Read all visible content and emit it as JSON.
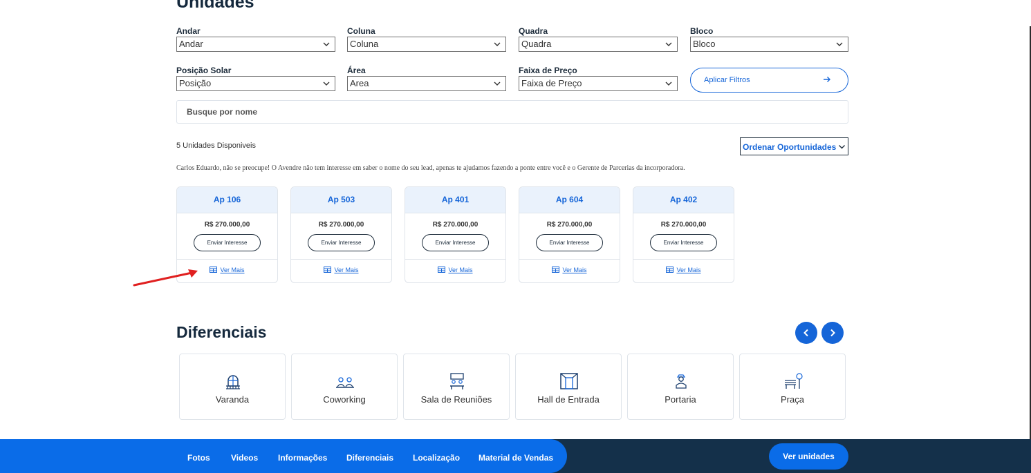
{
  "units": {
    "title": "Unidades",
    "filters": [
      {
        "label": "Andar",
        "value": "Andar"
      },
      {
        "label": "Coluna",
        "value": "Coluna"
      },
      {
        "label": "Quadra",
        "value": "Quadra"
      },
      {
        "label": "Bloco",
        "value": "Bloco"
      },
      {
        "label": "Posição Solar",
        "value": "Posição"
      },
      {
        "label": "Área",
        "value": "Area"
      },
      {
        "label": "Faixa de Preço",
        "value": "Faixa de Preço"
      }
    ],
    "apply_label": "Aplicar Filtros",
    "search_placeholder": "Busque por nome",
    "count_text": "5 Unidades Disponiveis",
    "order_label": "Ordenar Oportunidades",
    "note": "Carlos Eduardo, não se preocupe! O Avendre não tem interesse em saber o nome do seu lead, apenas te ajudamos fazendo a ponte entre você e o Gerente de Parcerias da incorporadora.",
    "cards": [
      {
        "name": "Ap 106",
        "price": "R$ 270.000,00",
        "interest": "Enviar Interesse",
        "more": "Ver Mais"
      },
      {
        "name": "Ap 503",
        "price": "R$ 270.000,00",
        "interest": "Enviar Interesse",
        "more": "Ver Mais"
      },
      {
        "name": "Ap 401",
        "price": "R$ 270.000,00",
        "interest": "Enviar Interesse",
        "more": "Ver Mais"
      },
      {
        "name": "Ap 604",
        "price": "R$ 270.000,00",
        "interest": "Enviar Interesse",
        "more": "Ver Mais"
      },
      {
        "name": "Ap 402",
        "price": "R$ 270.000,00",
        "interest": "Enviar Interesse",
        "more": "Ver Mais"
      }
    ]
  },
  "diferenciais": {
    "title": "Diferenciais",
    "items": [
      {
        "label": "Varanda",
        "icon": "balcony-icon"
      },
      {
        "label": "Coworking",
        "icon": "coworking-icon"
      },
      {
        "label": "Sala de Reuniões",
        "icon": "meeting-room-icon"
      },
      {
        "label": "Hall de Entrada",
        "icon": "entrance-hall-icon"
      },
      {
        "label": "Portaria",
        "icon": "doorman-icon"
      },
      {
        "label": "Praça",
        "icon": "park-bench-icon"
      }
    ]
  },
  "footer": {
    "nav": [
      "Fotos",
      "Videos",
      "Informações",
      "Diferenciais",
      "Localização",
      "Material de Vendas"
    ],
    "cta": "Ver unidades"
  },
  "colors": {
    "accent": "#1565d8",
    "footer_dark": "#14304a",
    "footer_pill": "#0a6ce8",
    "annotation": "#e02020"
  }
}
